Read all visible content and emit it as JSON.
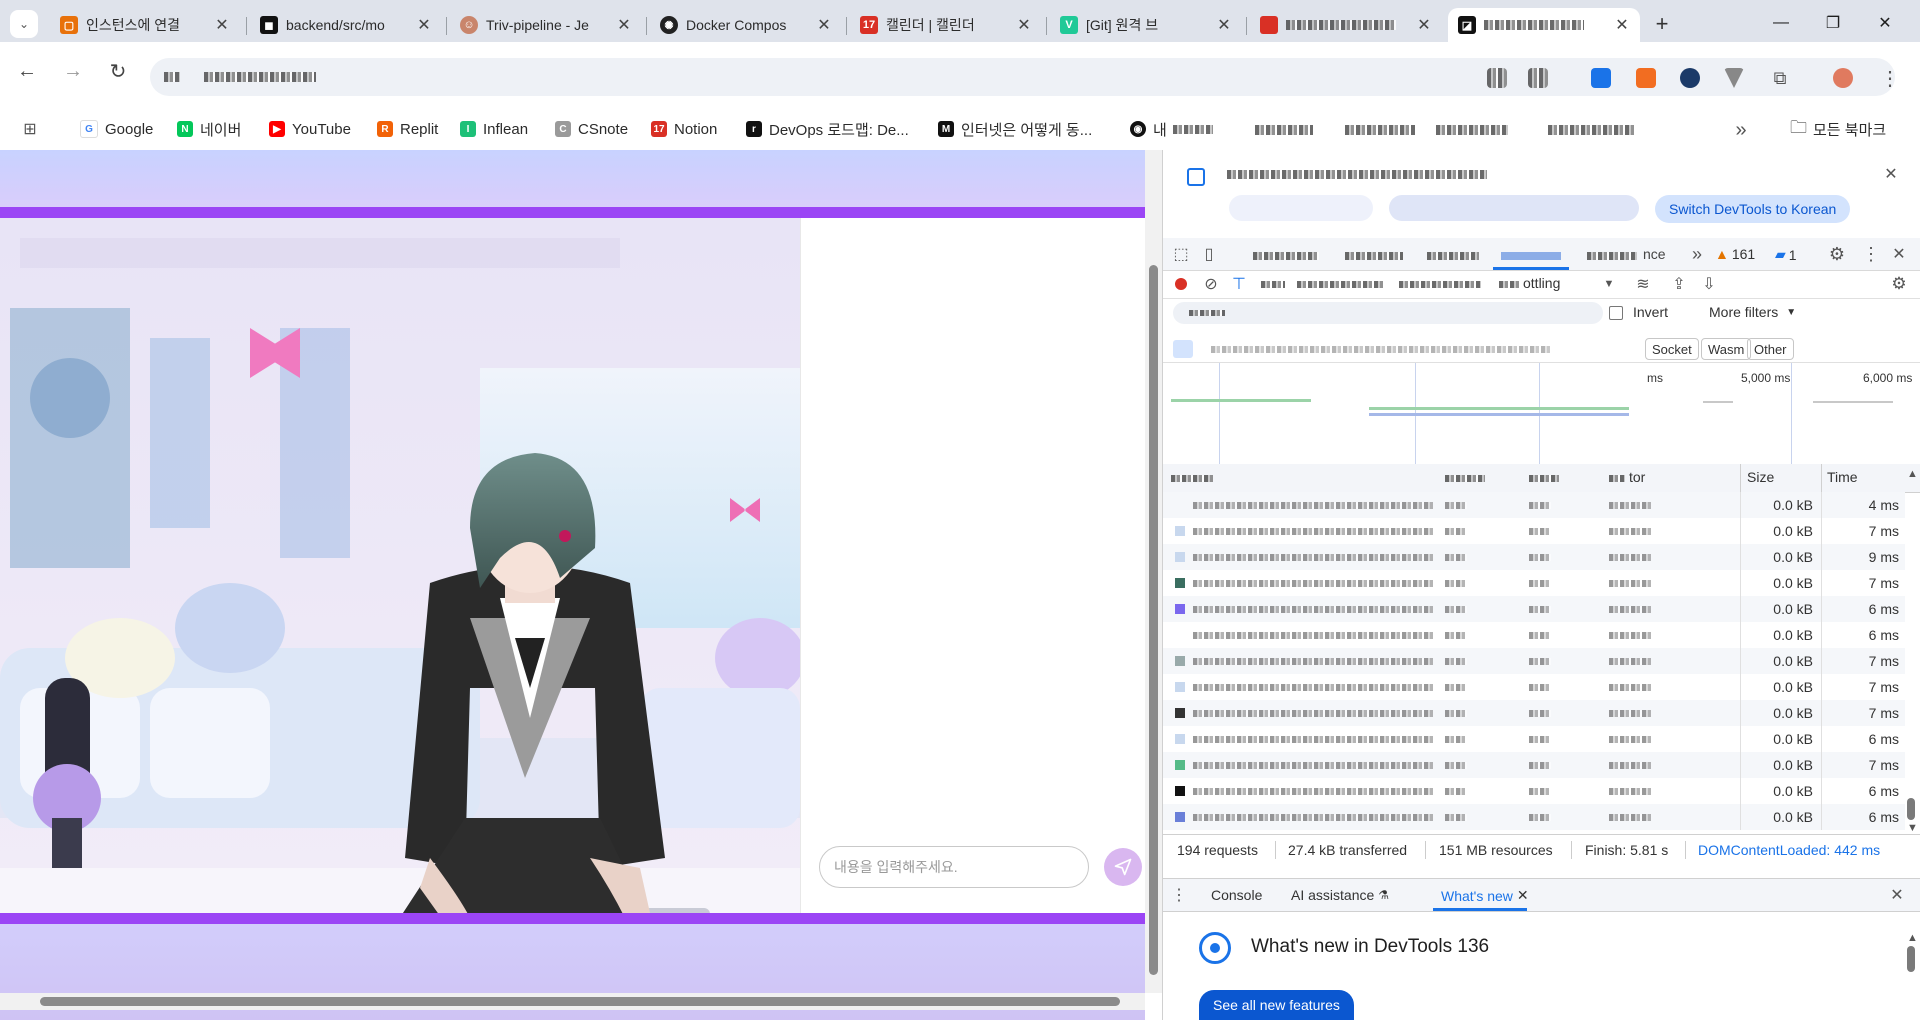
{
  "tabs": [
    {
      "title": "인스턴스에 연결",
      "fav_color": "#e8710a"
    },
    {
      "title": "backend/src/mo",
      "fav_color": "#111111"
    },
    {
      "title": "Triv-pipeline - Je",
      "fav_color": "#c9856b"
    },
    {
      "title": "Docker Compos",
      "fav_color": "#222222"
    },
    {
      "title": "캘린더 | 캘린더",
      "fav_color": "#d93025"
    },
    {
      "title": "[Git] 원격 브",
      "fav_color": "#20c997"
    },
    {
      "title": "",
      "fav_color": "#d93025"
    },
    {
      "title": "",
      "fav_color": "#111111"
    }
  ],
  "window": {
    "new_tab": "+",
    "minimize": "—",
    "restore": "❐",
    "close": "✕"
  },
  "toolbar": {
    "back": "←",
    "forward": "→",
    "reload": "↻"
  },
  "bookmarks": {
    "apps_icon": "apps-grid-icon",
    "items": [
      {
        "label": "Google",
        "color": "#4285f4",
        "glyph": "G"
      },
      {
        "label": "네이버",
        "color": "#03c75a",
        "glyph": "N"
      },
      {
        "label": "YouTube",
        "color": "#ff0000",
        "glyph": "▶"
      },
      {
        "label": "Replit",
        "color": "#f26207",
        "glyph": "R"
      },
      {
        "label": "Inflean",
        "color": "#1dc078",
        "glyph": "I"
      },
      {
        "label": "CSnote",
        "color": "#888888",
        "glyph": "C"
      },
      {
        "label": "Notion",
        "color": "#d93025",
        "glyph": "17"
      },
      {
        "label": "DevOps 로드맵: De...",
        "color": "#111111",
        "glyph": "r"
      },
      {
        "label": "인터넷은 어떻게 동...",
        "color": "#111111",
        "glyph": "M"
      },
      {
        "label": "내",
        "color": "#111111",
        "glyph": "◉"
      }
    ],
    "overflow": "»",
    "all_bookmarks": "모든 북마크"
  },
  "chat": {
    "placeholder": "내용을 입력해주세요."
  },
  "devtools": {
    "switch_lang_button": "Switch DevTools to Korean",
    "tabs_visible_fragment": "nce",
    "warnings_count": "161",
    "messages_count": "1",
    "throttle_fragment": "ottling",
    "invert_label": "Invert",
    "more_filters": "More filters",
    "type_filters": [
      "Socket",
      "Wasm",
      "Other"
    ],
    "timeline_labels": [
      "ms",
      "5,000 ms",
      "6,000 ms"
    ],
    "columns": {
      "initiator_fragment": "tor",
      "size": "Size",
      "time": "Time"
    },
    "rows": [
      {
        "size": "0.0 kB",
        "time": "4 ms"
      },
      {
        "size": "0.0 kB",
        "time": "7 ms"
      },
      {
        "size": "0.0 kB",
        "time": "9 ms"
      },
      {
        "size": "0.0 kB",
        "time": "7 ms"
      },
      {
        "size": "0.0 kB",
        "time": "6 ms"
      },
      {
        "size": "0.0 kB",
        "time": "6 ms"
      },
      {
        "size": "0.0 kB",
        "time": "7 ms"
      },
      {
        "size": "0.0 kB",
        "time": "7 ms"
      },
      {
        "size": "0.0 kB",
        "time": "7 ms"
      },
      {
        "size": "0.0 kB",
        "time": "6 ms"
      },
      {
        "size": "0.0 kB",
        "time": "7 ms"
      },
      {
        "size": "0.0 kB",
        "time": "6 ms"
      },
      {
        "size": "0.0 kB",
        "time": "6 ms"
      }
    ],
    "status": {
      "requests": "194 requests",
      "transferred": "27.4 kB transferred",
      "resources": "151 MB resources",
      "finish": "Finish: 5.81 s",
      "dcl": "DOMContentLoaded: 442 ms"
    },
    "drawer_tabs": [
      "Console",
      "AI assistance",
      "What's new"
    ],
    "whats_new_title": "What's new in DevTools 136",
    "see_all_button": "See all new features"
  }
}
